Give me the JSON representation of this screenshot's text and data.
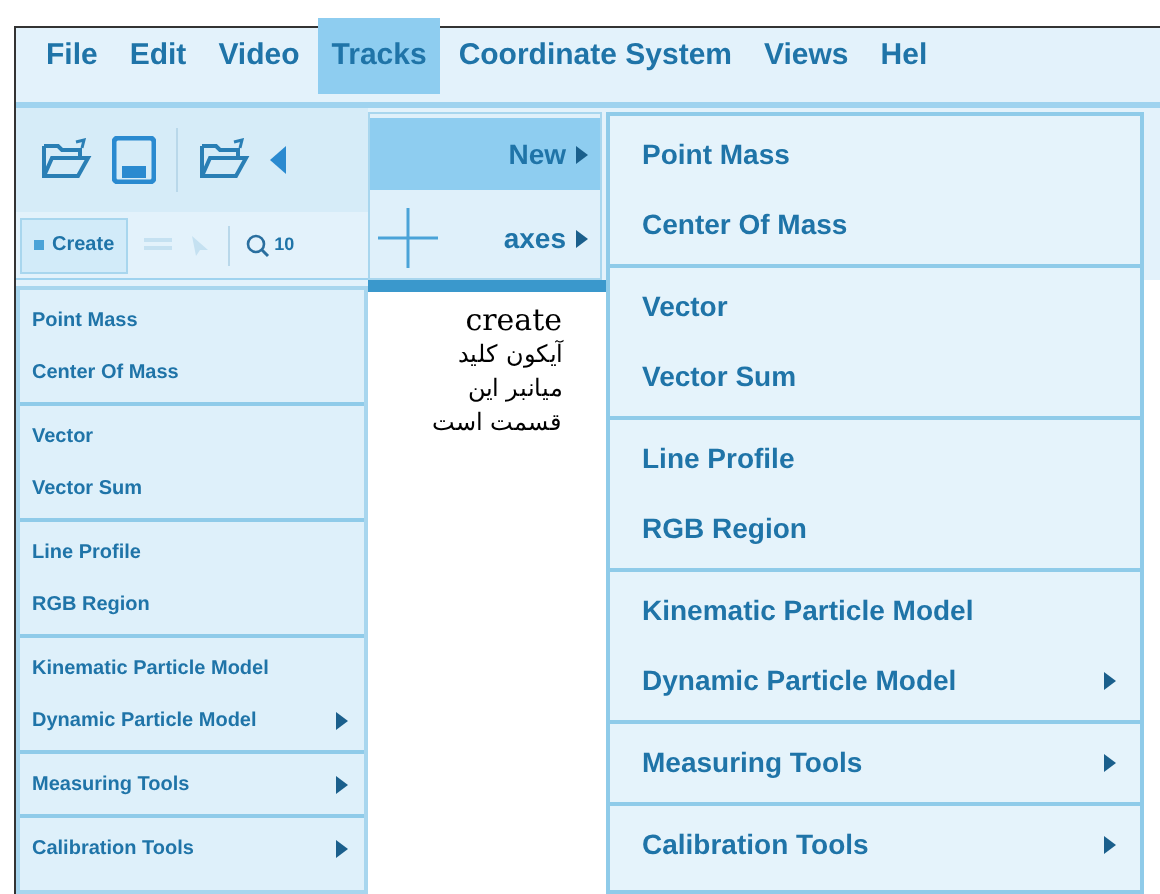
{
  "menubar": [
    {
      "label": "File",
      "selected": false
    },
    {
      "label": "Edit",
      "selected": false
    },
    {
      "label": "Video",
      "selected": false
    },
    {
      "label": "Tracks",
      "selected": true
    },
    {
      "label": "Coordinate System",
      "selected": false
    },
    {
      "label": "Views",
      "selected": false
    },
    {
      "label": "Hel",
      "selected": false
    }
  ],
  "tracks_menu": [
    {
      "label": "New",
      "selected": true,
      "submenu": true,
      "kind": "plain"
    },
    {
      "label": "axes",
      "selected": false,
      "submenu": true,
      "kind": "axes"
    }
  ],
  "new_submenu": [
    [
      {
        "label": "Point Mass",
        "submenu": false
      },
      {
        "label": "Center Of Mass",
        "submenu": false
      }
    ],
    [
      {
        "label": "Vector",
        "submenu": false
      },
      {
        "label": "Vector Sum",
        "submenu": false
      }
    ],
    [
      {
        "label": "Line Profile",
        "submenu": false
      },
      {
        "label": "RGB Region",
        "submenu": false
      }
    ],
    [
      {
        "label": "Kinematic Particle Model",
        "submenu": false
      },
      {
        "label": "Dynamic Particle Model",
        "submenu": true
      }
    ],
    [
      {
        "label": "Measuring Tools",
        "submenu": true
      }
    ],
    [
      {
        "label": "Calibration Tools",
        "submenu": true
      }
    ]
  ],
  "toolbar2": {
    "create_button": "Create",
    "zoom": "10"
  },
  "create_menu": [
    [
      {
        "label": "Point Mass",
        "submenu": false
      },
      {
        "label": "Center Of Mass",
        "submenu": false
      }
    ],
    [
      {
        "label": "Vector",
        "submenu": false
      },
      {
        "label": "Vector Sum",
        "submenu": false
      }
    ],
    [
      {
        "label": "Line Profile",
        "submenu": false
      },
      {
        "label": "RGB Region",
        "submenu": false
      }
    ],
    [
      {
        "label": "Kinematic Particle Model",
        "submenu": false
      },
      {
        "label": "Dynamic Particle Model",
        "submenu": true
      }
    ],
    [
      {
        "label": "Measuring Tools",
        "submenu": true
      }
    ],
    [
      {
        "label": "Calibration Tools",
        "submenu": true
      }
    ]
  ],
  "annotation": [
    "create",
    "آیکون کلید",
    "میانبر این",
    "قسمت است"
  ]
}
